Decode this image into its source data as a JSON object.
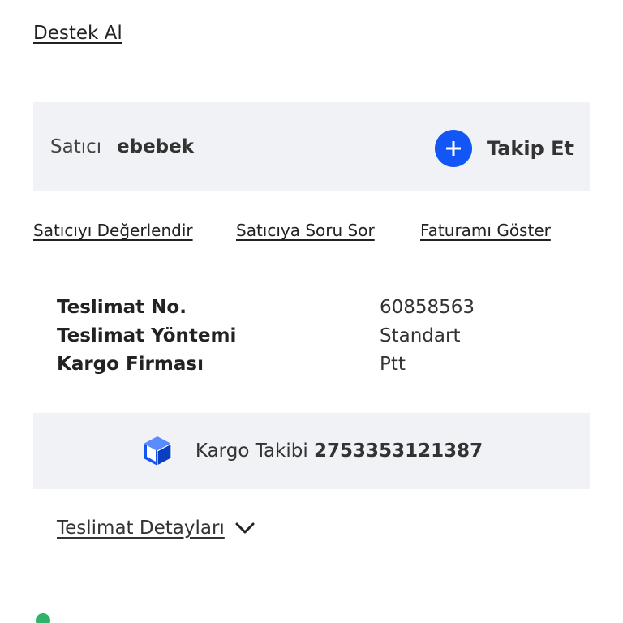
{
  "support": {
    "label": "Destek Al"
  },
  "seller": {
    "label": "Satıcı",
    "name": "ebebek",
    "follow_label": "Takip Et",
    "follow_icon": "plus-circle-icon",
    "accent_color": "#1256f5"
  },
  "actions": {
    "rate_seller": "Satıcıyı Değerlendir",
    "ask_seller": "Satıcıya Soru Sor",
    "show_invoice": "Faturamı Göster"
  },
  "delivery_info": [
    {
      "label": "Teslimat No.",
      "value": "60858563"
    },
    {
      "label": "Teslimat Yöntemi",
      "value": "Standart"
    },
    {
      "label": "Kargo Firması",
      "value": "Ptt"
    }
  ],
  "tracking": {
    "icon": "package-box-icon",
    "label": "Kargo Takibi",
    "number": "2753353121387"
  },
  "details": {
    "label": "Teslimat Detayları",
    "icon": "chevron-down-icon"
  }
}
